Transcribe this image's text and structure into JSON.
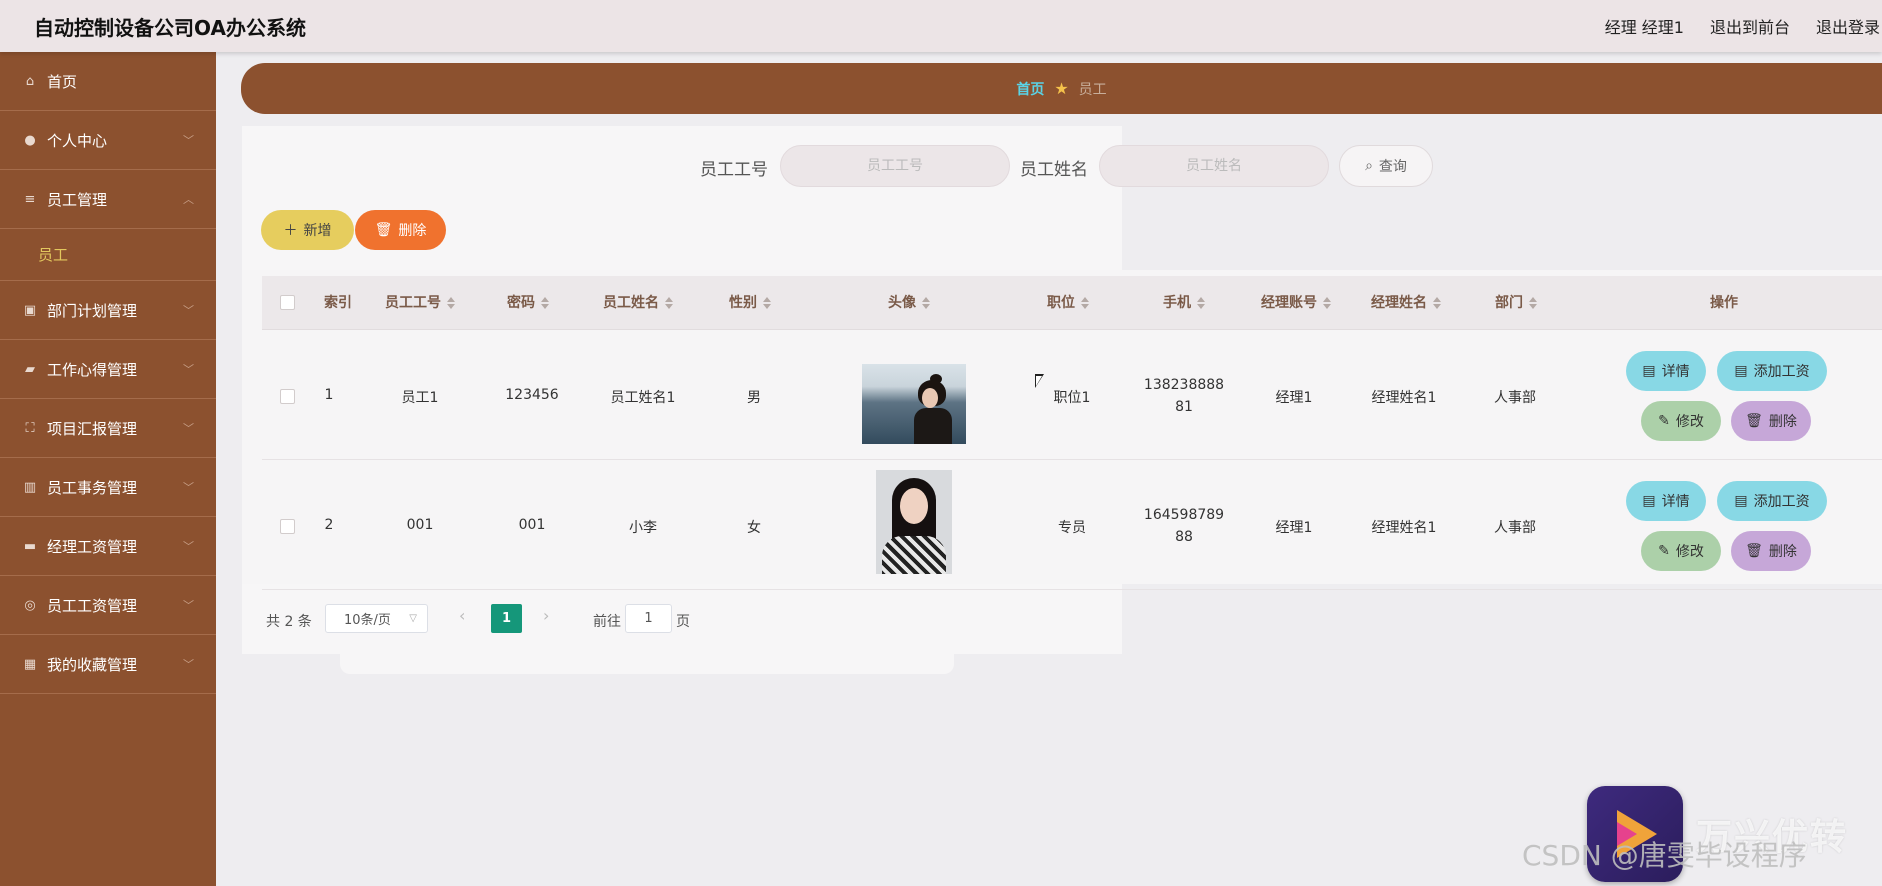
{
  "header": {
    "title": "自动控制设备公司OA办公系统",
    "user": "经理 经理1",
    "to_front": "退出到前台",
    "logout": "退出登录"
  },
  "sidebar": {
    "items": [
      {
        "label": "首页",
        "icon": "home-icon"
      },
      {
        "label": "个人中心",
        "icon": "user-icon"
      },
      {
        "label": "员工管理",
        "icon": "list-icon"
      },
      {
        "label": "部门计划管理",
        "icon": "calendar-icon"
      },
      {
        "label": "工作心得管理",
        "icon": "people-icon"
      },
      {
        "label": "项目汇报管理",
        "icon": "frame-icon"
      },
      {
        "label": "员工事务管理",
        "icon": "chart-icon"
      },
      {
        "label": "经理工资管理",
        "icon": "monitor-icon"
      },
      {
        "label": "员工工资管理",
        "icon": "target-icon"
      },
      {
        "label": "我的收藏管理",
        "icon": "grid-icon"
      }
    ],
    "active_sub": "员工"
  },
  "breadcrumb": {
    "home": "首页",
    "current": "员工"
  },
  "search": {
    "field1_label": "员工工号",
    "field1_placeholder": "员工工号",
    "field2_label": "员工姓名",
    "field2_placeholder": "员工姓名",
    "query_label": "查询"
  },
  "toolbar": {
    "add_label": "新增",
    "delete_label": "删除"
  },
  "table": {
    "headers": [
      "索引",
      "员工工号",
      "密码",
      "员工姓名",
      "性别",
      "头像",
      "职位",
      "手机",
      "经理账号",
      "经理姓名",
      "部门",
      "操作"
    ],
    "rows": [
      {
        "index": "1",
        "emp_no": "员工1",
        "password": "123456",
        "name": "员工姓名1",
        "gender": "男",
        "position": "职位1",
        "phone": "13823888881",
        "manager_account": "经理1",
        "manager_name": "经理姓名1",
        "department": "人事部"
      },
      {
        "index": "2",
        "emp_no": "001",
        "password": "001",
        "name": "小李",
        "gender": "女",
        "position": "专员",
        "phone": "16459878988",
        "manager_account": "经理1",
        "manager_name": "经理姓名1",
        "department": "人事部"
      }
    ],
    "actions": {
      "detail": "详情",
      "add_salary": "添加工资",
      "edit": "修改",
      "remove": "删除"
    }
  },
  "pagination": {
    "total": "共 2 条",
    "page_size": "10条/页",
    "current_page": "1",
    "goto_label": "前往",
    "goto_value": "1",
    "page_unit": "页"
  },
  "watermark": {
    "text": "CSDN @唐雯毕设程序",
    "brand": "万兴优转"
  },
  "colors": {
    "sidebar": "#8c512f",
    "accent_teal": "#88d8e5",
    "accent_green": "#acd0a9",
    "accent_purple": "#c6a7d8",
    "add_yellow": "#e6cd5e",
    "delete_orange": "#f0722e",
    "page_active": "#15977a"
  }
}
